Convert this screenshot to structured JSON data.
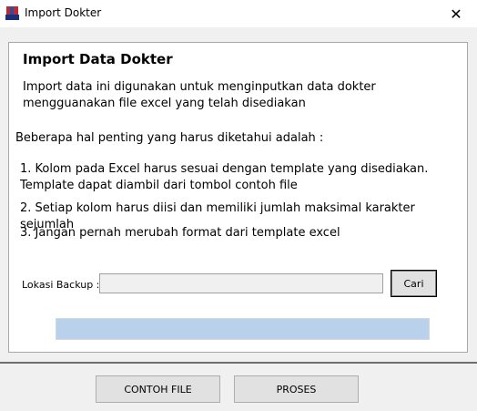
{
  "window": {
    "title": "Import Dokter",
    "close_label": "✕"
  },
  "panel": {
    "heading": "Import Data Dokter",
    "description": "Import data ini digunakan untuk menginputkan data dokter mengguanakan file excel yang telah disediakan",
    "intro": "Beberapa hal penting yang harus diketahui adalah :",
    "points": [
      "1. Kolom pada Excel harus sesuai dengan template yang disediakan. Template dapat diambil dari tombol contoh file",
      "2. Setiap kolom harus diisi dan memiliki jumlah maksimal karakter sejumlah",
      "3. Jangan pernah merubah format dari template excel"
    ]
  },
  "backup": {
    "label": "Lokasi Backup :",
    "value": "",
    "button_label": "Cari"
  },
  "footer": {
    "contoh_label": "CONTOH FILE",
    "proses_label": "PROSES"
  }
}
